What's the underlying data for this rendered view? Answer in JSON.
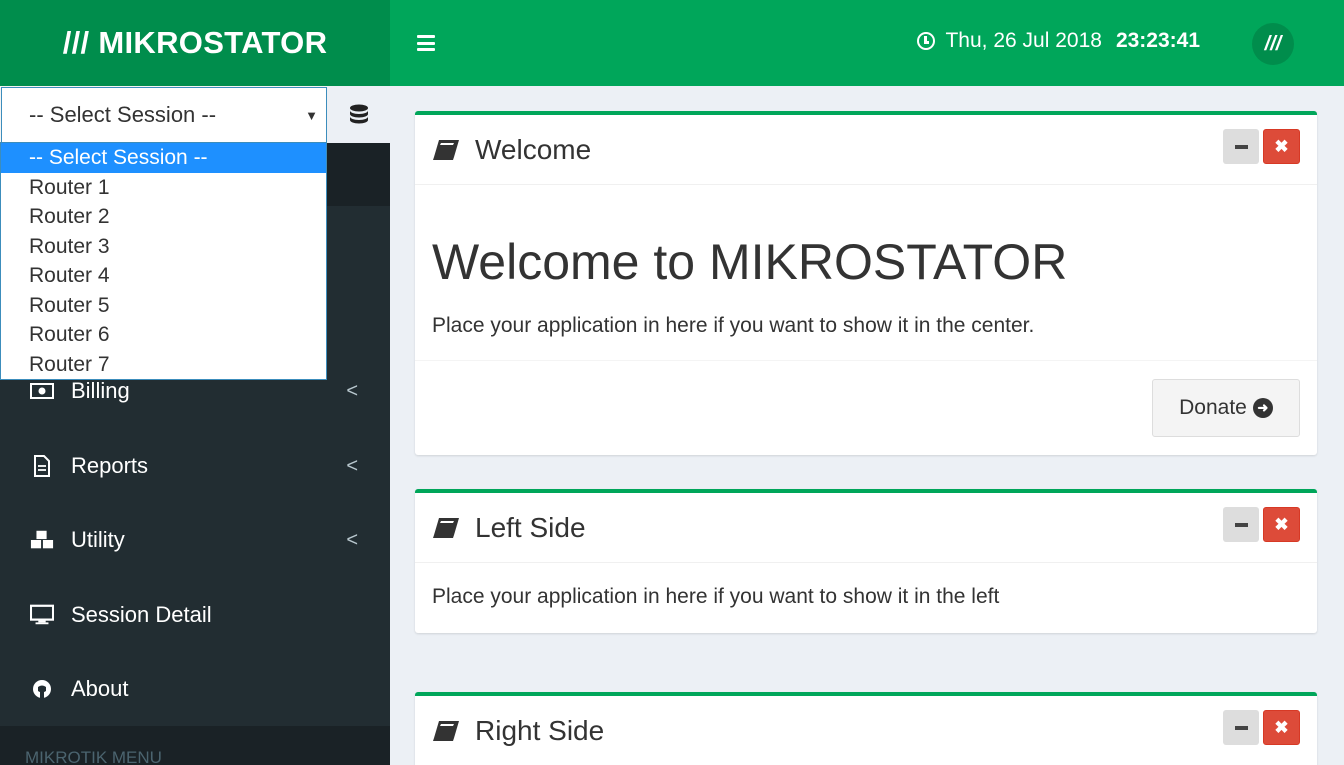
{
  "header": {
    "logo_text": "/// MIKROSTATOR",
    "date": "Thu, 26 Jul 2018",
    "time": "23:23:41",
    "avatar_text": "///",
    "brand_color": "#00a65a",
    "brand_dark": "#008d4c"
  },
  "sidebar": {
    "session_select": {
      "selected": "-- Select Session --",
      "options": [
        "-- Select Session --",
        "Router 1",
        "Router 2",
        "Router 3",
        "Router 4",
        "Router 5",
        "Router 6",
        "Router 7"
      ]
    },
    "items": [
      {
        "label": "Billing",
        "icon": "money-icon",
        "has_submenu": true
      },
      {
        "label": "Reports",
        "icon": "file-text-icon",
        "has_submenu": true
      },
      {
        "label": "Utility",
        "icon": "cubes-icon",
        "has_submenu": true
      },
      {
        "label": "Session Detail",
        "icon": "desktop-icon",
        "has_submenu": false
      },
      {
        "label": "About",
        "icon": "github-icon",
        "has_submenu": false
      }
    ],
    "section_header": "MIKROTIK MENU"
  },
  "main": {
    "welcome_box": {
      "title": "Welcome",
      "heading": "Welcome to MIKROSTATOR",
      "text": "Place your application in here if you want to show it in the center.",
      "donate_label": "Donate"
    },
    "left_box": {
      "title": "Left Side",
      "text": "Place your application in here if you want to show it in the left"
    },
    "right_box": {
      "title": "Right Side"
    }
  }
}
